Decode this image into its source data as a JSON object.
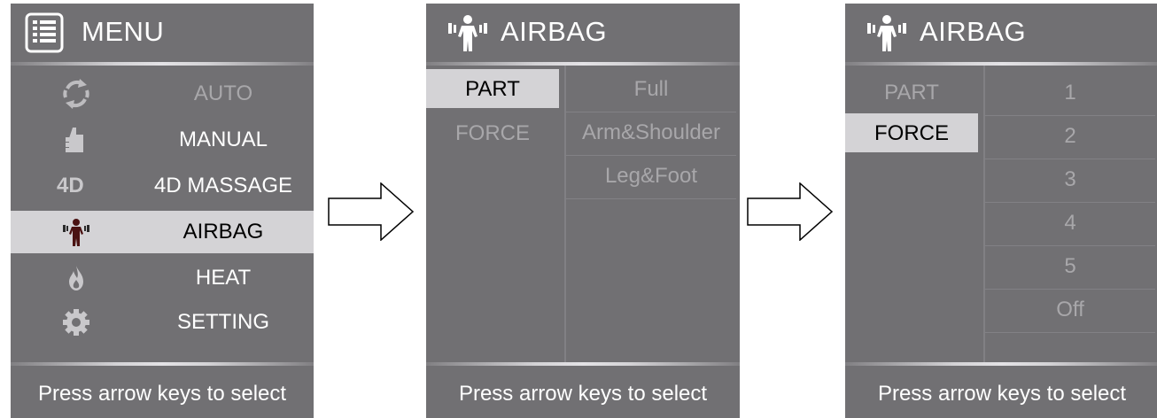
{
  "menu_panel": {
    "title": "MENU",
    "items": [
      {
        "label": "AUTO",
        "icon": "refresh-icon",
        "enabled": false
      },
      {
        "label": "MANUAL",
        "icon": "thumbs-up-icon",
        "enabled": true
      },
      {
        "label": "4D MASSAGE",
        "icon_text": "4D",
        "icon": "4d-icon",
        "enabled": true
      },
      {
        "label": "AIRBAG",
        "icon": "airbag-body-icon",
        "enabled": true,
        "selected": true
      },
      {
        "label": "HEAT",
        "icon": "flame-icon",
        "enabled": true
      },
      {
        "label": "SETTING",
        "icon": "gear-icon",
        "enabled": true
      }
    ],
    "footer": "Press arrow keys to select"
  },
  "airbag_part_panel": {
    "title": "AIRBAG",
    "left_items": [
      {
        "label": "PART",
        "selected": true
      },
      {
        "label": "FORCE",
        "selected": false
      }
    ],
    "options": [
      "Full",
      "Arm&Shoulder",
      "Leg&Foot"
    ],
    "footer": "Press arrow keys to select"
  },
  "airbag_force_panel": {
    "title": "AIRBAG",
    "left_items": [
      {
        "label": "PART",
        "selected": false
      },
      {
        "label": "FORCE",
        "selected": true
      }
    ],
    "options": [
      "1",
      "2",
      "3",
      "4",
      "5",
      "Off"
    ],
    "footer": "Press arrow keys to select"
  },
  "colors": {
    "panel_bg": "#717073",
    "selected_bg": "#d4d3d6",
    "dim_text": "#a8a7aa",
    "text": "#ffffff"
  }
}
